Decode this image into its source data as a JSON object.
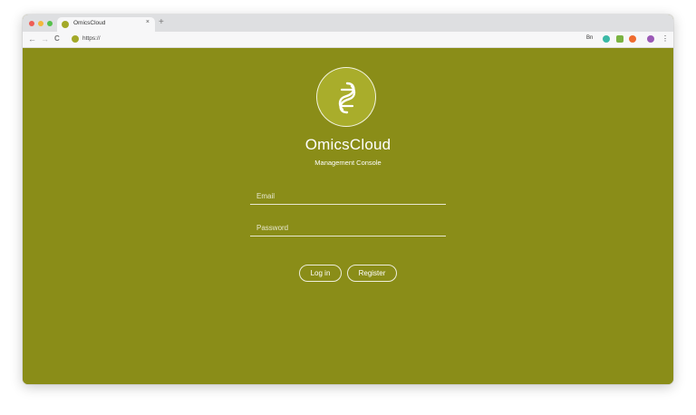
{
  "browser": {
    "tab_title": "OmicsCloud",
    "tab_close": "×",
    "new_tab": "+",
    "url": "https://",
    "back": "←",
    "forward": "→",
    "reload": "C",
    "extension_text": "Bn",
    "menu": "⋮"
  },
  "page": {
    "brand": "OmicsCloud",
    "subtitle": "Management Console",
    "email_placeholder": "Email",
    "password_placeholder": "Password",
    "login_label": "Log in",
    "register_label": "Register"
  },
  "colors": {
    "page_background": "#8a8d18",
    "logo_fill": "#a9ad2b",
    "text": "#ffffff"
  },
  "icons": [
    "omicscloud-logo-icon",
    "back-arrow-icon",
    "forward-arrow-icon",
    "reload-icon",
    "site-favicon-icon",
    "extension-icon",
    "profile-avatar-icon",
    "menu-dots-icon"
  ]
}
